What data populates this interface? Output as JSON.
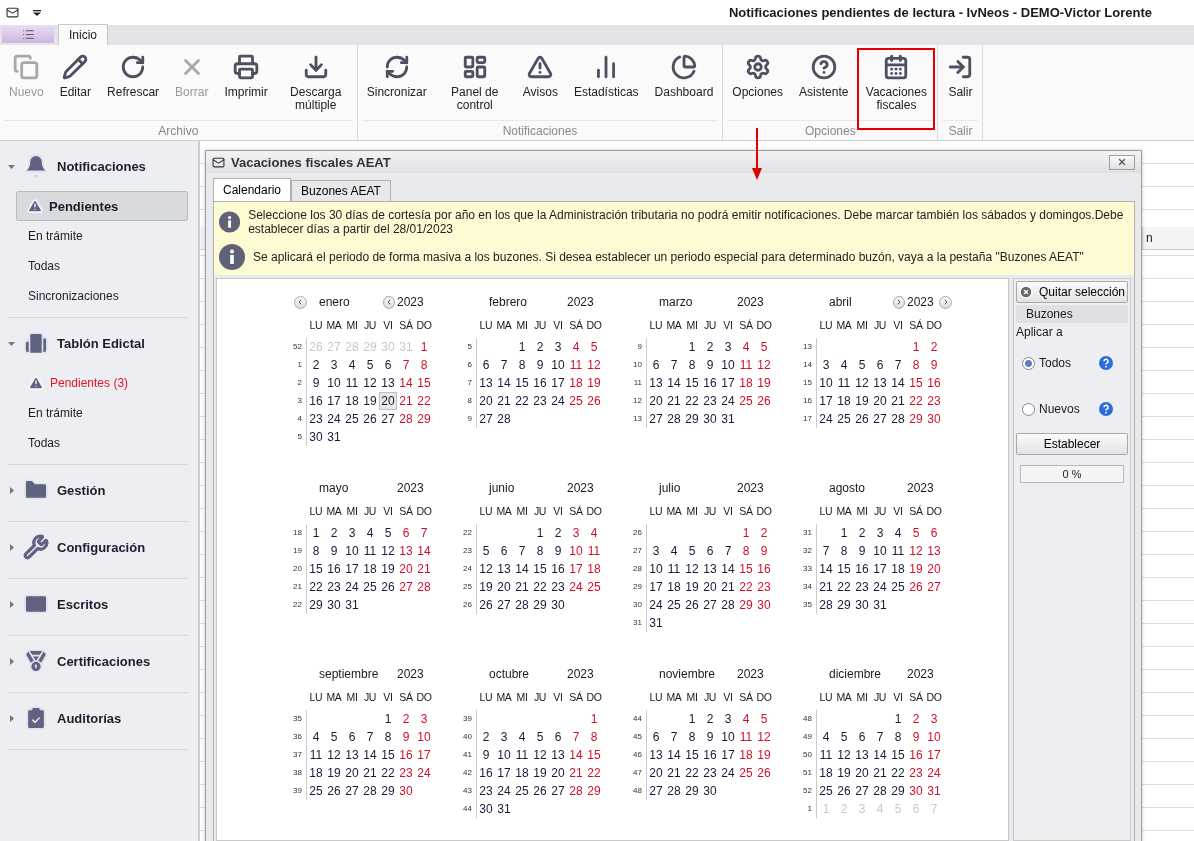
{
  "window": {
    "title": "Notificaciones pendientes de lectura - IvNeos - DEMO-Victor Lorente"
  },
  "ribbon": {
    "tabs": [
      {
        "label": "Inicio",
        "selected": true
      }
    ],
    "groups": [
      {
        "label": "Archivo",
        "buttons": [
          {
            "label": "Nuevo",
            "disabled": true,
            "highlighted": false
          },
          {
            "label": "Editar",
            "disabled": false,
            "highlighted": false
          },
          {
            "label": "Refrescar",
            "disabled": false,
            "highlighted": false
          },
          {
            "label": "Borrar",
            "disabled": true,
            "highlighted": false
          },
          {
            "label": "Imprimir",
            "disabled": false,
            "highlighted": false
          },
          {
            "label": "Descarga múltiple",
            "disabled": false,
            "highlighted": false
          }
        ]
      },
      {
        "label": "Notificaciones",
        "buttons": [
          {
            "label": "Sincronizar",
            "disabled": false,
            "highlighted": false
          },
          {
            "label": "Panel de control",
            "disabled": false,
            "highlighted": false
          },
          {
            "label": "Avisos",
            "disabled": false,
            "highlighted": false
          },
          {
            "label": "Estadísticas",
            "disabled": false,
            "highlighted": false
          },
          {
            "label": "Dashboard",
            "disabled": false,
            "highlighted": false
          }
        ]
      },
      {
        "label": "Opciones",
        "buttons": [
          {
            "label": "Opciones",
            "disabled": false,
            "highlighted": false
          },
          {
            "label": "Asistente",
            "disabled": false,
            "highlighted": false
          },
          {
            "label": "Vacaciones fiscales",
            "disabled": false,
            "highlighted": true
          }
        ]
      },
      {
        "label": "Salir",
        "buttons": [
          {
            "label": "Salir",
            "disabled": false,
            "highlighted": false
          }
        ]
      }
    ]
  },
  "sidebar": {
    "groups": [
      {
        "title": "Notificaciones",
        "expanded": true,
        "items": [
          {
            "label": "Pendientes",
            "kind": "alert",
            "selected": true
          },
          {
            "label": "En trámite",
            "kind": "plain",
            "selected": false
          },
          {
            "label": "Todas",
            "kind": "plain",
            "selected": false
          },
          {
            "label": "Sincronizaciones",
            "kind": "plain",
            "selected": false
          }
        ]
      },
      {
        "title": "Tablón Edictal",
        "expanded": true,
        "items": [
          {
            "label": "Pendientes (3)",
            "kind": "warning",
            "selected": false
          },
          {
            "label": "En trámite",
            "kind": "plain",
            "selected": false
          },
          {
            "label": "Todas",
            "kind": "plain",
            "selected": false
          }
        ]
      },
      {
        "title": "Gestión",
        "expanded": false
      },
      {
        "title": "Configuración",
        "expanded": false
      },
      {
        "title": "Escritos",
        "expanded": false
      },
      {
        "title": "Certificaciones",
        "expanded": false
      },
      {
        "title": "Auditorías",
        "expanded": false
      }
    ]
  },
  "background_table": {
    "column_1": "n"
  },
  "dialog": {
    "title": "Vacaciones fiscales AEAT",
    "tabs": [
      {
        "label": "Calendario",
        "selected": true
      },
      {
        "label": "Buzones AEAT",
        "selected": false
      }
    ],
    "notes": [
      "Seleccione los 30 días  de cortesía por año en los que la Administración tributaria no podrá emitir notificaciones. Debe marcar también los sábados y domingos.Debe establecer días a partir del 28/01/2023",
      "Se aplicará el periodo de forma masiva a los buzones. Si desea establecer un periodo especial para determinado buzón, vaya a la pestaña \"Buzones AEAT\""
    ],
    "months": [
      {
        "name": "enero",
        "year": "2023",
        "prev_arrows": true,
        "weekdays": [
          "LU",
          "MA",
          "MI",
          "JU",
          "VI",
          "SÁ",
          "DO"
        ],
        "weeks": [
          {
            "number": "52",
            "prev_days": [
              "26",
              "27",
              "28",
              "29",
              "30",
              "31"
            ],
            "days": [
              "1"
            ]
          },
          {
            "number": "1",
            "days": [
              "2",
              "3",
              "4",
              "5",
              "6",
              "7",
              "8"
            ]
          },
          {
            "number": "2",
            "days": [
              "9",
              "10",
              "11",
              "12",
              "13",
              "14",
              "15"
            ]
          },
          {
            "number": "3",
            "days": [
              "16",
              "17",
              "18",
              "19",
              {
                "day": "20",
                "today": true
              },
              "21",
              "22"
            ]
          },
          {
            "number": "4",
            "days": [
              "23",
              "24",
              "25",
              "26",
              "27",
              "28",
              "29"
            ]
          },
          {
            "number": "5",
            "days": [
              "30",
              "31"
            ]
          }
        ]
      },
      {
        "name": "febrero",
        "year": "2023",
        "weekdays": [
          "LU",
          "MA",
          "MI",
          "JU",
          "VI",
          "SÁ",
          "DO"
        ],
        "weeks": [
          {
            "number": "5",
            "days": [
              "1",
              "2",
              "3",
              "4",
              "5"
            ]
          },
          {
            "number": "6",
            "days": [
              "6",
              "7",
              "8",
              "9",
              "10",
              "11",
              "12"
            ]
          },
          {
            "number": "7",
            "days": [
              "13",
              "14",
              "15",
              "16",
              "17",
              "18",
              "19"
            ]
          },
          {
            "number": "8",
            "days": [
              "20",
              "21",
              "22",
              "23",
              "24",
              "25",
              "26"
            ]
          },
          {
            "number": "9",
            "days": [
              "27",
              "28"
            ]
          }
        ]
      },
      {
        "name": "marzo",
        "year": "2023",
        "weekdays": [
          "LU",
          "MA",
          "MI",
          "JU",
          "VI",
          "SÁ",
          "DO"
        ],
        "weeks": [
          {
            "number": "9",
            "days": [
              "1",
              "2",
              "3",
              "4",
              "5"
            ]
          },
          {
            "number": "10",
            "days": [
              "6",
              "7",
              "8",
              "9",
              "10",
              "11",
              "12"
            ]
          },
          {
            "number": "11",
            "days": [
              "13",
              "14",
              "15",
              "16",
              "17",
              "18",
              "19"
            ]
          },
          {
            "number": "12",
            "days": [
              "20",
              "21",
              "22",
              "23",
              "24",
              "25",
              "26"
            ]
          },
          {
            "number": "13",
            "days": [
              "27",
              "28",
              "29",
              "30",
              "31"
            ]
          }
        ]
      },
      {
        "name": "abril",
        "year": "2023",
        "next_arrows": true,
        "weekdays": [
          "LU",
          "MA",
          "MI",
          "JU",
          "VI",
          "SÁ",
          "DO"
        ],
        "weeks": [
          {
            "number": "13",
            "days": [
              "1",
              "2"
            ]
          },
          {
            "number": "14",
            "days": [
              "3",
              "4",
              "5",
              "6",
              "7",
              "8",
              "9"
            ]
          },
          {
            "number": "15",
            "days": [
              "10",
              "11",
              "12",
              "13",
              "14",
              "15",
              "16"
            ]
          },
          {
            "number": "16",
            "days": [
              "17",
              "18",
              "19",
              "20",
              "21",
              "22",
              "23"
            ]
          },
          {
            "number": "17",
            "days": [
              "24",
              "25",
              "26",
              "27",
              "28",
              "29",
              "30"
            ]
          }
        ]
      },
      {
        "name": "mayo",
        "year": "2023",
        "weekdays": [
          "LU",
          "MA",
          "MI",
          "JU",
          "VI",
          "SÁ",
          "DO"
        ],
        "weeks": [
          {
            "number": "18",
            "days": [
              "1",
              "2",
              "3",
              "4",
              "5",
              "6",
              "7"
            ]
          },
          {
            "number": "19",
            "days": [
              "8",
              "9",
              "10",
              "11",
              "12",
              "13",
              "14"
            ]
          },
          {
            "number": "20",
            "days": [
              "15",
              "16",
              "17",
              "18",
              "19",
              "20",
              "21"
            ]
          },
          {
            "number": "21",
            "days": [
              "22",
              "23",
              "24",
              "25",
              "26",
              "27",
              "28"
            ]
          },
          {
            "number": "22",
            "days": [
              "29",
              "30",
              "31"
            ]
          }
        ]
      },
      {
        "name": "junio",
        "year": "2023",
        "weekdays": [
          "LU",
          "MA",
          "MI",
          "JU",
          "VI",
          "SÁ",
          "DO"
        ],
        "weeks": [
          {
            "number": "22",
            "days": [
              "1",
              "2",
              "3",
              "4"
            ]
          },
          {
            "number": "23",
            "days": [
              "5",
              "6",
              "7",
              "8",
              "9",
              "10",
              "11"
            ]
          },
          {
            "number": "24",
            "days": [
              "12",
              "13",
              "14",
              "15",
              "16",
              "17",
              "18"
            ]
          },
          {
            "number": "25",
            "days": [
              "19",
              "20",
              "21",
              "22",
              "23",
              "24",
              "25"
            ]
          },
          {
            "number": "26",
            "days": [
              "26",
              "27",
              "28",
              "29",
              "30"
            ]
          }
        ]
      },
      {
        "name": "julio",
        "year": "2023",
        "weekdays": [
          "LU",
          "MA",
          "MI",
          "JU",
          "VI",
          "SÁ",
          "DO"
        ],
        "weeks": [
          {
            "number": "26",
            "days": [
              "1",
              "2"
            ]
          },
          {
            "number": "27",
            "days": [
              "3",
              "4",
              "5",
              "6",
              "7",
              "8",
              "9"
            ]
          },
          {
            "number": "28",
            "days": [
              "10",
              "11",
              "12",
              "13",
              "14",
              "15",
              "16"
            ]
          },
          {
            "number": "29",
            "days": [
              "17",
              "18",
              "19",
              "20",
              "21",
              "22",
              "23"
            ]
          },
          {
            "number": "30",
            "days": [
              "24",
              "25",
              "26",
              "27",
              "28",
              "29",
              "30"
            ]
          },
          {
            "number": "31",
            "days": [
              "31"
            ]
          }
        ]
      },
      {
        "name": "agosto",
        "year": "2023",
        "weekdays": [
          "LU",
          "MA",
          "MI",
          "JU",
          "VI",
          "SÁ",
          "DO"
        ],
        "weeks": [
          {
            "number": "31",
            "days": [
              "1",
              "2",
              "3",
              "4",
              "5",
              "6"
            ]
          },
          {
            "number": "32",
            "days": [
              "7",
              "8",
              "9",
              "10",
              "11",
              "12",
              "13"
            ]
          },
          {
            "number": "33",
            "days": [
              "14",
              "15",
              "16",
              "17",
              "18",
              "19",
              "20"
            ]
          },
          {
            "number": "34",
            "days": [
              "21",
              "22",
              "23",
              "24",
              "25",
              "26",
              "27"
            ]
          },
          {
            "number": "35",
            "days": [
              "28",
              "29",
              "30",
              "31"
            ]
          }
        ]
      },
      {
        "name": "septiembre",
        "year": "2023",
        "weekdays": [
          "LU",
          "MA",
          "MI",
          "JU",
          "VI",
          "SÁ",
          "DO"
        ],
        "weeks": [
          {
            "number": "35",
            "days": [
              "1",
              "2",
              "3"
            ]
          },
          {
            "number": "36",
            "days": [
              "4",
              "5",
              "6",
              "7",
              "8",
              "9",
              "10"
            ]
          },
          {
            "number": "37",
            "days": [
              "11",
              "12",
              "13",
              "14",
              "15",
              "16",
              "17"
            ]
          },
          {
            "number": "38",
            "days": [
              "18",
              "19",
              "20",
              "21",
              "22",
              "23",
              "24"
            ]
          },
          {
            "number": "39",
            "days": [
              "25",
              "26",
              "27",
              "28",
              "29",
              "30"
            ]
          }
        ]
      },
      {
        "name": "octubre",
        "year": "2023",
        "weekdays": [
          "LU",
          "MA",
          "MI",
          "JU",
          "VI",
          "SÁ",
          "DO"
        ],
        "weeks": [
          {
            "number": "39",
            "days": [
              "1"
            ]
          },
          {
            "number": "40",
            "days": [
              "2",
              "3",
              "4",
              "5",
              "6",
              "7",
              "8"
            ]
          },
          {
            "number": "41",
            "days": [
              "9",
              "10",
              "11",
              "12",
              "13",
              "14",
              "15"
            ]
          },
          {
            "number": "42",
            "days": [
              "16",
              "17",
              "18",
              "19",
              "20",
              "21",
              "22"
            ]
          },
          {
            "number": "43",
            "days": [
              "23",
              "24",
              "25",
              "26",
              "27",
              "28",
              "29"
            ]
          },
          {
            "number": "44",
            "days": [
              "30",
              "31"
            ]
          }
        ]
      },
      {
        "name": "noviembre",
        "year": "2023",
        "weekdays": [
          "LU",
          "MA",
          "MI",
          "JU",
          "VI",
          "SÁ",
          "DO"
        ],
        "weeks": [
          {
            "number": "44",
            "days": [
              "1",
              "2",
              "3",
              "4",
              "5"
            ]
          },
          {
            "number": "45",
            "days": [
              "6",
              "7",
              "8",
              "9",
              "10",
              "11",
              "12"
            ]
          },
          {
            "number": "46",
            "days": [
              "13",
              "14",
              "15",
              "16",
              "17",
              "18",
              "19"
            ]
          },
          {
            "number": "47",
            "days": [
              "20",
              "21",
              "22",
              "23",
              "24",
              "25",
              "26"
            ]
          },
          {
            "number": "48",
            "days": [
              "27",
              "28",
              "29",
              "30"
            ]
          }
        ]
      },
      {
        "name": "diciembre",
        "year": "2023",
        "weekdays": [
          "LU",
          "MA",
          "MI",
          "JU",
          "VI",
          "SÁ",
          "DO"
        ],
        "weeks": [
          {
            "number": "48",
            "days": [
              "1",
              "2",
              "3"
            ]
          },
          {
            "number": "49",
            "days": [
              "4",
              "5",
              "6",
              "7",
              "8",
              "9",
              "10"
            ]
          },
          {
            "number": "50",
            "days": [
              "11",
              "12",
              "13",
              "14",
              "15",
              "16",
              "17"
            ]
          },
          {
            "number": "51",
            "days": [
              "18",
              "19",
              "20",
              "21",
              "22",
              "23",
              "24"
            ]
          },
          {
            "number": "52",
            "days": [
              "25",
              "26",
              "27",
              "28",
              "29",
              "30",
              "31"
            ]
          },
          {
            "number": "1",
            "next_days": [
              "1",
              "2",
              "3",
              "4",
              "5",
              "6",
              "7"
            ]
          }
        ]
      }
    ],
    "side_panel": {
      "clear_button": "Quitar selección",
      "section_title": "Buzones",
      "apply_label": "Aplicar a",
      "options": [
        {
          "label": "Todos",
          "selected": true
        },
        {
          "label": "Nuevos",
          "selected": false
        }
      ],
      "set_button": "Establecer",
      "progress": {
        "text": "0 %",
        "level": 0
      }
    }
  }
}
